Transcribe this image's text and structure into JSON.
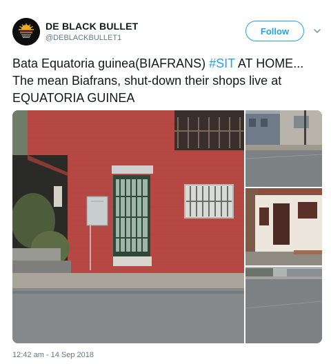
{
  "author": {
    "name": "DE BLACK BULLET",
    "handle": "@DEBLACKBULLET1",
    "avatar_text": "BIAFRA WILL BE FREE"
  },
  "actions": {
    "follow_label": "Follow",
    "menu_icon": "chevron-down-icon"
  },
  "tweet": {
    "text_before": "Bata Equatoria guinea(BIAFRANS) ",
    "hashtag": "#SIT",
    "text_after": " AT HOME... The mean Biafrans, shut-down their shops live at EQUATORIA GUINEA"
  },
  "media": {
    "photo_count": 4
  },
  "meta": {
    "timestamp": "12:42 am - 14 Sep 2018"
  },
  "colors": {
    "accent": "#1da1f2",
    "text": "#14171a",
    "muted": "#657786"
  }
}
